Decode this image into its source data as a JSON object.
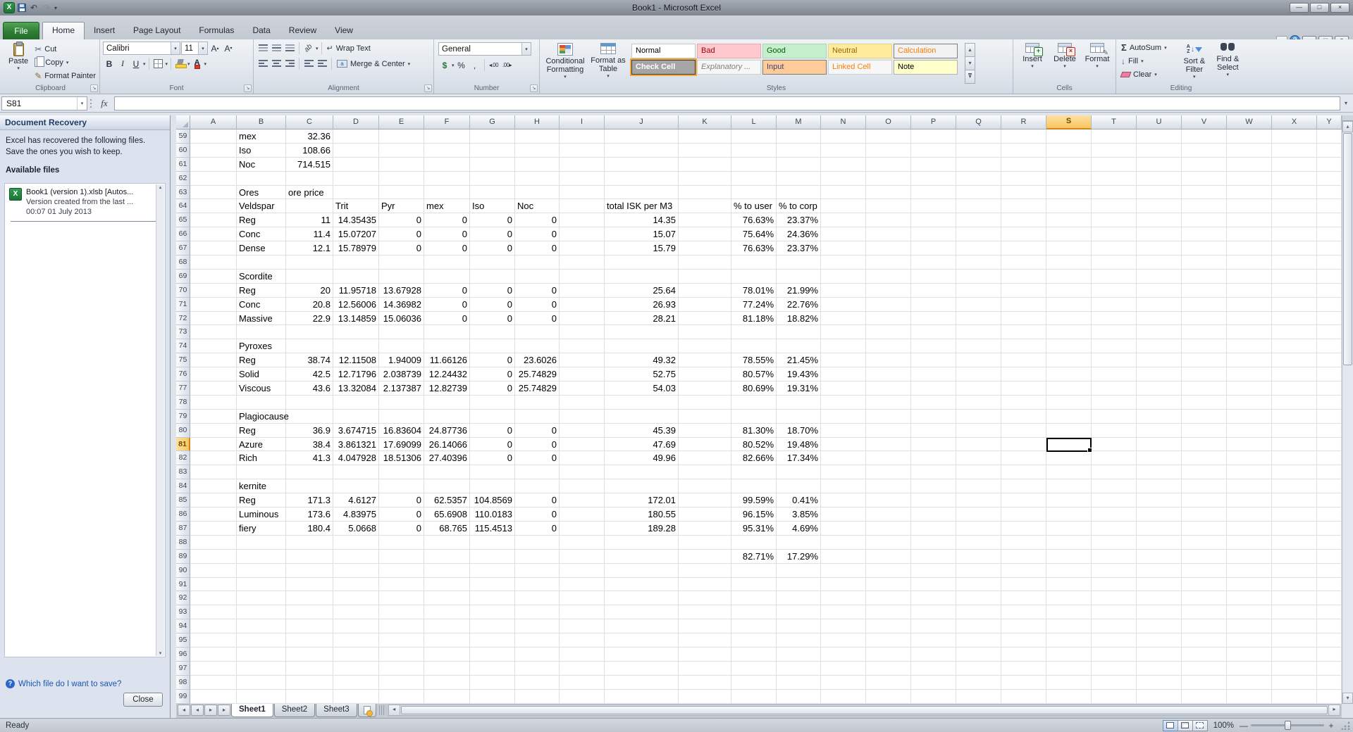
{
  "titlebar": {
    "title": "Book1 - Microsoft Excel"
  },
  "icons": {
    "dropdown": "▾",
    "up": "▴",
    "down": "▾",
    "left": "◂",
    "right": "▸",
    "launcher": "↘",
    "undo": "↶",
    "redo": "↷",
    "cut": "✂",
    "format_painter": "✎",
    "autosum": "Σ",
    "fill_down": "↓",
    "orientation": "ab",
    "wrap": "↵",
    "dollar": "$",
    "percent": "%",
    "comma": ",",
    "increase_decimal": "◂.00",
    "decrease_decimal": ".00▸",
    "minimize": "—",
    "maximize": "□",
    "close": "×",
    "help": "?",
    "logo": "X",
    "grow_font": "A",
    "shrink_font": "A",
    "merge_letter": "a"
  },
  "ribbon_tabs": {
    "file": "File",
    "tabs": [
      "Home",
      "Insert",
      "Page Layout",
      "Formulas",
      "Data",
      "Review",
      "View"
    ],
    "active": "Home"
  },
  "ribbon": {
    "clipboard": {
      "group": "Clipboard",
      "paste": "Paste",
      "cut": "Cut",
      "copy": "Copy",
      "format_painter": "Format Painter"
    },
    "font": {
      "group": "Font",
      "font_name": "Calibri",
      "font_size": "11",
      "bold": "B",
      "italic": "I",
      "underline": "U"
    },
    "alignment": {
      "group": "Alignment",
      "wrap_text": "Wrap Text",
      "merge_center": "Merge & Center"
    },
    "number": {
      "group": "Number",
      "format": "General"
    },
    "styles": {
      "group": "Styles",
      "conditional_formatting": "Conditional Formatting",
      "format_as_table": "Format as Table",
      "gallery": [
        {
          "label": "Normal",
          "bg": "#ffffff",
          "fg": "#000000",
          "border": "#c6c6c6"
        },
        {
          "label": "Bad",
          "bg": "#ffc7ce",
          "fg": "#9c0006",
          "border": "#e8aab1"
        },
        {
          "label": "Good",
          "bg": "#c6efce",
          "fg": "#006100",
          "border": "#a9d6b2"
        },
        {
          "label": "Neutral",
          "bg": "#ffeb9c",
          "fg": "#9c6500",
          "border": "#e6d489"
        },
        {
          "label": "Calculation",
          "bg": "#f2f2f2",
          "fg": "#fa7d00",
          "border": "#7f7f7f"
        },
        {
          "label": "Check Cell",
          "bg": "#a5a5a5",
          "fg": "#ffffff",
          "border": "#3f3f3f",
          "bold": true,
          "selected": true
        },
        {
          "label": "Explanatory ...",
          "bg": "#f7f7f7",
          "fg": "#7f7f7f",
          "border": "#d0d0d0",
          "italic": true
        },
        {
          "label": "Input",
          "bg": "#ffcc99",
          "fg": "#3f3f76",
          "border": "#7f7f7f"
        },
        {
          "label": "Linked Cell",
          "bg": "#f7f7f7",
          "fg": "#fa7d00",
          "border": "#d0d0d0"
        },
        {
          "label": "Note",
          "bg": "#ffffcc",
          "fg": "#000000",
          "border": "#b2b2b2"
        }
      ]
    },
    "cells": {
      "group": "Cells",
      "insert": "Insert",
      "delete": "Delete",
      "format": "Format"
    },
    "editing": {
      "group": "Editing",
      "autosum": "AutoSum",
      "fill": "Fill",
      "clear": "Clear",
      "sort_filter": "Sort & Filter",
      "find_select": "Find & Select"
    }
  },
  "formula_bar": {
    "name_box": "S81",
    "fx": "fx",
    "formula": ""
  },
  "recovery": {
    "title": "Document Recovery",
    "message": "Excel has recovered the following files.  Save the ones you wish to keep.",
    "available_files": "Available files",
    "file_name": "Book1 (version 1).xlsb  [Autos...",
    "file_detail": "Version created from the last ...",
    "file_time": "00:07 01 July 2013",
    "help_link": "Which file do I want to save?",
    "close": "Close"
  },
  "sheet": {
    "selected_cell": "S81",
    "selected_column": "S",
    "selected_row": 81,
    "first_row": 59,
    "last_row": 99,
    "columns": [
      "A",
      "B",
      "C",
      "D",
      "E",
      "F",
      "G",
      "H",
      "I",
      "J",
      "K",
      "L",
      "M",
      "N",
      "O",
      "P",
      "Q",
      "R",
      "S",
      "T",
      "U",
      "V",
      "W",
      "X",
      "Y"
    ],
    "col_widths": {
      "A": 66,
      "B": 70,
      "C": 67,
      "D": 65,
      "E": 64,
      "F": 65,
      "G": 64,
      "H": 63,
      "I": 64,
      "J": 105,
      "K": 75,
      "L": 64,
      "M": 63,
      "Y": 35,
      "default": 64
    },
    "rows": {
      "59": {
        "B": "mex",
        "C": "32.36"
      },
      "60": {
        "B": "Iso",
        "C": "108.66"
      },
      "61": {
        "B": "Noc",
        "C": "714.515"
      },
      "63": {
        "B": "Ores",
        "C": "ore price"
      },
      "64": {
        "B": "Veldspar",
        "D": "Trit",
        "E": "Pyr",
        "F": "mex",
        "G": "Iso",
        "H": "Noc",
        "J": "total ISK per M3",
        "L": "% to user",
        "M": "% to corp"
      },
      "65": {
        "B": "Reg",
        "C": "11",
        "D": "14.35435",
        "E": "0",
        "F": "0",
        "G": "0",
        "H": "0",
        "J": "14.35",
        "L": "76.63%",
        "M": "23.37%"
      },
      "66": {
        "B": "Conc",
        "C": "11.4",
        "D": "15.07207",
        "E": "0",
        "F": "0",
        "G": "0",
        "H": "0",
        "J": "15.07",
        "L": "75.64%",
        "M": "24.36%"
      },
      "67": {
        "B": "Dense",
        "C": "12.1",
        "D": "15.78979",
        "E": "0",
        "F": "0",
        "G": "0",
        "H": "0",
        "J": "15.79",
        "L": "76.63%",
        "M": "23.37%"
      },
      "69": {
        "B": "Scordite"
      },
      "70": {
        "B": "Reg",
        "C": "20",
        "D": "11.95718",
        "E": "13.67928",
        "F": "0",
        "G": "0",
        "H": "0",
        "J": "25.64",
        "L": "78.01%",
        "M": "21.99%"
      },
      "71": {
        "B": "Conc",
        "C": "20.8",
        "D": "12.56006",
        "E": "14.36982",
        "F": "0",
        "G": "0",
        "H": "0",
        "J": "26.93",
        "L": "77.24%",
        "M": "22.76%"
      },
      "72": {
        "B": "Massive",
        "C": "22.9",
        "D": "13.14859",
        "E": "15.06036",
        "F": "0",
        "G": "0",
        "H": "0",
        "J": "28.21",
        "L": "81.18%",
        "M": "18.82%"
      },
      "74": {
        "B": "Pyroxes"
      },
      "75": {
        "B": "Reg",
        "C": "38.74",
        "D": "12.11508",
        "E": "1.94009",
        "F": "11.66126",
        "G": "0",
        "H": "23.6026",
        "J": "49.32",
        "L": "78.55%",
        "M": "21.45%"
      },
      "76": {
        "B": "Solid",
        "C": "42.5",
        "D": "12.71796",
        "E": "2.038739",
        "F": "12.24432",
        "G": "0",
        "H": "25.74829",
        "J": "52.75",
        "L": "80.57%",
        "M": "19.43%"
      },
      "77": {
        "B": "Viscous",
        "C": "43.6",
        "D": "13.32084",
        "E": "2.137387",
        "F": "12.82739",
        "G": "0",
        "H": "25.74829",
        "J": "54.03",
        "L": "80.69%",
        "M": "19.31%"
      },
      "79": {
        "B": "Plagiocause"
      },
      "80": {
        "B": "Reg",
        "C": "36.9",
        "D": "3.674715",
        "E": "16.83604",
        "F": "24.87736",
        "G": "0",
        "H": "0",
        "J": "45.39",
        "L": "81.30%",
        "M": "18.70%"
      },
      "81": {
        "B": "Azure",
        "C": "38.4",
        "D": "3.861321",
        "E": "17.69099",
        "F": "26.14066",
        "G": "0",
        "H": "0",
        "J": "47.69",
        "L": "80.52%",
        "M": "19.48%"
      },
      "82": {
        "B": "Rich",
        "C": "41.3",
        "D": "4.047928",
        "E": "18.51306",
        "F": "27.40396",
        "G": "0",
        "H": "0",
        "J": "49.96",
        "L": "82.66%",
        "M": "17.34%"
      },
      "84": {
        "B": "kernite"
      },
      "85": {
        "B": "Reg",
        "C": "171.3",
        "D": "4.6127",
        "E": "0",
        "F": "62.5357",
        "G": "104.8569",
        "H": "0",
        "J": "172.01",
        "L": "99.59%",
        "M": "0.41%"
      },
      "86": {
        "B": "Luminous",
        "C": "173.6",
        "D": "4.83975",
        "E": "0",
        "F": "65.6908",
        "G": "110.0183",
        "H": "0",
        "J": "180.55",
        "L": "96.15%",
        "M": "3.85%"
      },
      "87": {
        "B": "fiery",
        "C": "180.4",
        "D": "5.0668",
        "E": "0",
        "F": "68.765",
        "G": "115.4513",
        "H": "0",
        "J": "189.28",
        "L": "95.31%",
        "M": "4.69%"
      },
      "89": {
        "L": "82.71%",
        "M": "17.29%"
      }
    }
  },
  "sheet_tabs": {
    "tabs": [
      "Sheet1",
      "Sheet2",
      "Sheet3"
    ],
    "active": "Sheet1"
  },
  "status": {
    "mode": "Ready",
    "zoom": "100%"
  }
}
